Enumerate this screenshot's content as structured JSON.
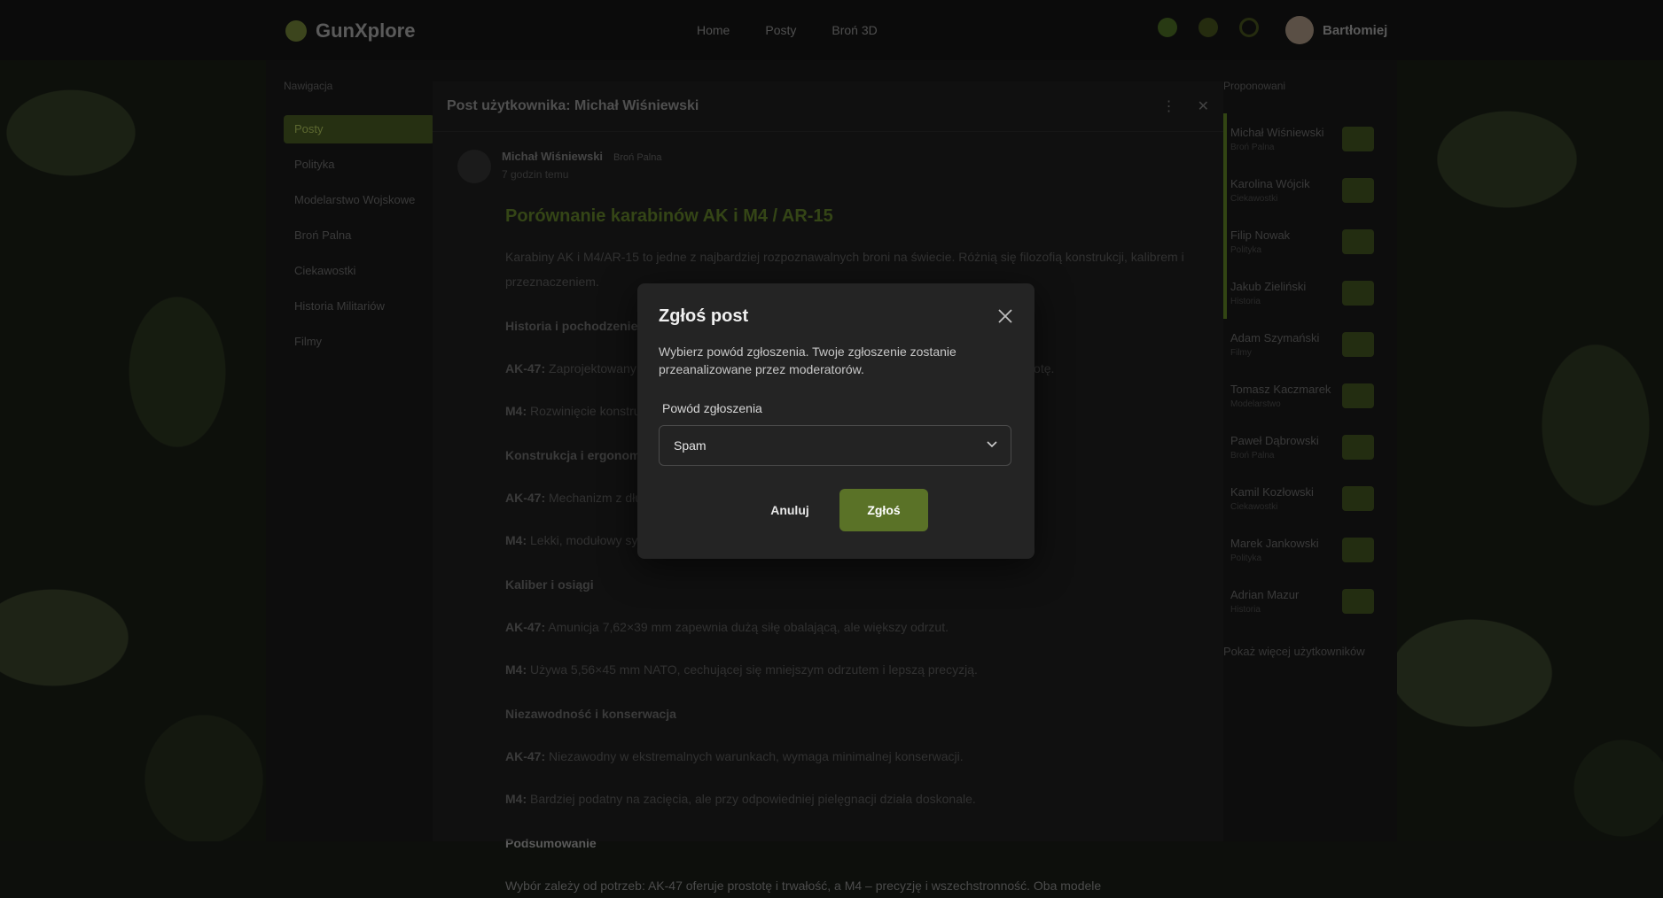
{
  "colors": {
    "accent": "#5a7227",
    "dialog_bg": "#242424",
    "page_bg": "#141414"
  },
  "header": {
    "brand": "GunXplore",
    "nav": [
      "Home",
      "Posty",
      "Broń 3D"
    ],
    "icons": [
      "leaf-icon",
      "bell-icon",
      "moon-icon"
    ],
    "username": "Bartłomiej"
  },
  "sidebar": {
    "heading": "Nawigacja",
    "items": [
      {
        "label": "Posty"
      },
      {
        "label": "Polityka"
      },
      {
        "label": "Modelarstwo Wojskowe"
      },
      {
        "label": "Broń Palna"
      },
      {
        "label": "Ciekawostki"
      },
      {
        "label": "Historia Militariów"
      },
      {
        "label": "Filmy"
      }
    ]
  },
  "right_panel": {
    "heading": "Proponowani",
    "users": [
      {
        "name": "Michał Wiśniewski",
        "sub": "Broń Palna"
      },
      {
        "name": "Karolina Wójcik",
        "sub": "Ciekawostki"
      },
      {
        "name": "Filip Nowak",
        "sub": "Polityka"
      },
      {
        "name": "Jakub Zieliński",
        "sub": "Historia"
      },
      {
        "name": "Adam Szymański",
        "sub": "Filmy"
      },
      {
        "name": "Tomasz Kaczmarek",
        "sub": "Modelarstwo"
      },
      {
        "name": "Paweł Dąbrowski",
        "sub": "Broń Palna"
      },
      {
        "name": "Kamil Kozłowski",
        "sub": "Ciekawostki"
      },
      {
        "name": "Marek Jankowski",
        "sub": "Polityka"
      },
      {
        "name": "Adrian Mazur",
        "sub": "Historia"
      }
    ],
    "more": "Pokaż więcej użytkowników"
  },
  "post": {
    "header_title": "Post użytkownika: Michał Wiśniewski",
    "author": "Michał Wiśniewski",
    "badge": "Broń Palna",
    "time": "7 godzin temu",
    "title": "Porównanie karabinów AK i M4 / AR-15",
    "intro": "Karabiny AK i M4/AR-15 to jedne z najbardziej rozpoznawalnych broni na świecie. Różnią się filozofią konstrukcji, kalibrem i przeznaczeniem.",
    "sections": [
      {
        "heading": "Historia i pochodzenie",
        "lines": [
          {
            "bold": "AK-47:",
            "text": " Zaprojektowany przez Michaiła Kałasznikowa w ZSRR, ceniony za niezawodność i prostotę."
          },
          {
            "bold": "M4:",
            "text": " Rozwinięcie konstrukcji AR-15 Eugene'a Stonera, standard armii USA od lat 90."
          }
        ]
      },
      {
        "heading": "Konstrukcja i ergonomia",
        "lines": [
          {
            "bold": "AK-47:",
            "text": " Mechanizm z długim skokiem tłoka gazowego, mniej ergonomiczny."
          },
          {
            "bold": "M4:",
            "text": " Lekki, modułowy system, łatwy w dostosowaniu do wielu akcesoriów i zastosowań."
          }
        ]
      },
      {
        "heading": "Kaliber i osiągi",
        "lines": [
          {
            "bold": "AK-47:",
            "text": " Amunicja 7,62×39 mm zapewnia dużą siłę obalającą, ale większy odrzut."
          },
          {
            "bold": "M4:",
            "text": " Używa 5,56×45 mm NATO, cechującej się mniejszym odrzutem i lepszą precyzją."
          }
        ]
      },
      {
        "heading": "Niezawodność i konserwacja",
        "lines": [
          {
            "bold": "AK-47:",
            "text": " Niezawodny w ekstremalnych warunkach, wymaga minimalnej konserwacji."
          },
          {
            "bold": "M4:",
            "text": " Bardziej podatny na zacięcia, ale przy odpowiedniej pielęgnacji działa doskonale."
          }
        ]
      },
      {
        "heading": "Podsumowanie",
        "lines": [
          {
            "bold": "",
            "text": "Wybór zależy od potrzeb: AK-47 oferuje prostotę i trwałość, a M4 – precyzję i wszechstronność. Oba modele"
          }
        ]
      }
    ]
  },
  "report_dialog": {
    "title": "Zgłoś post",
    "description": "Wybierz powód zgłoszenia. Twoje zgłoszenie zostanie przeanalizowane przez moderatorów.",
    "reason_label": "Powód zgłoszenia",
    "reason_value": "Spam",
    "cancel_label": "Anuluj",
    "submit_label": "Zgłoś"
  }
}
